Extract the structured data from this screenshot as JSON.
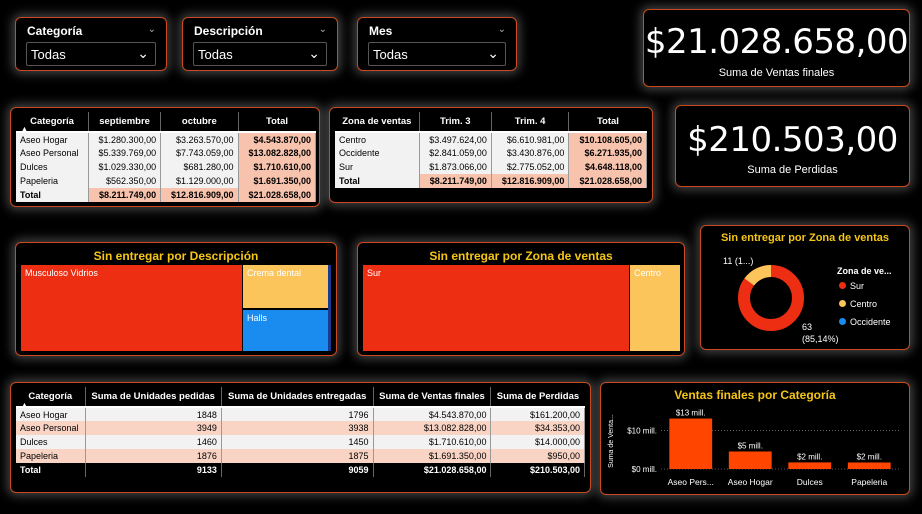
{
  "slicers": [
    {
      "title": "Categoría",
      "value": "Todas"
    },
    {
      "title": "Descripción",
      "value": "Todas"
    },
    {
      "title": "Mes",
      "value": "Todas"
    }
  ],
  "kpi_sales": {
    "value": "$21.028.658,00",
    "label": "Suma de Ventas finales"
  },
  "kpi_losses": {
    "value": "$210.503,00",
    "label": "Suma de Perdidas"
  },
  "table_month": {
    "headers": [
      "Categoría",
      "septiembre",
      "octubre",
      "Total"
    ],
    "rows": [
      [
        "Aseo Hogar",
        "$1.280.300,00",
        "$3.263.570,00",
        "$4.543.870,00"
      ],
      [
        "Aseo Personal",
        "$5.339.769,00",
        "$7.743.059,00",
        "$13.082.828,00"
      ],
      [
        "Dulces",
        "$1.029.330,00",
        "$681.280,00",
        "$1.710.610,00"
      ],
      [
        "Papeleria",
        "$562.350,00",
        "$1.129.000,00",
        "$1.691.350,00"
      ]
    ],
    "total": [
      "Total",
      "$8.211.749,00",
      "$12.816.909,00",
      "$21.028.658,00"
    ]
  },
  "table_zone": {
    "headers": [
      "Zona de ventas",
      "Trim. 3",
      "Trim. 4",
      "Total"
    ],
    "rows": [
      [
        "Centro",
        "$3.497.624,00",
        "$6.610.981,00",
        "$10.108.605,00"
      ],
      [
        "Occidente",
        "$2.841.059,00",
        "$3.430.876,00",
        "$6.271.935,00"
      ],
      [
        "Sur",
        "$1.873.066,00",
        "$2.775.052,00",
        "$4.648.118,00"
      ]
    ],
    "total": [
      "Total",
      "$8.211.749,00",
      "$12.816.909,00",
      "$21.028.658,00"
    ]
  },
  "treemap_desc": {
    "title": "Sin entregar por Descripción",
    "cells": [
      {
        "label": "Musculoso Vidrios",
        "color": "#ee2e13"
      },
      {
        "label": "Crema dental",
        "color": "#fbc55c"
      },
      {
        "label": "Halls",
        "color": "#1a8cf0"
      }
    ]
  },
  "treemap_zone": {
    "title": "Sin entregar por Zona de ventas",
    "cells": [
      {
        "label": "Sur",
        "color": "#ee2e13"
      },
      {
        "label": "Centro",
        "color": "#fbc55c"
      }
    ]
  },
  "donut": {
    "title": "Sin entregar por Zona de ventas",
    "legend_title": "Zona de ve...",
    "legend": [
      {
        "label": "Sur",
        "color": "#ee2e13"
      },
      {
        "label": "Centro",
        "color": "#fbc55c"
      },
      {
        "label": "Occidente",
        "color": "#1a8cf0"
      }
    ],
    "label_small": "11 (1...)",
    "label_big_1": "63",
    "label_big_2": "(85,14%)",
    "values": [
      63,
      11
    ]
  },
  "table_units": {
    "headers": [
      "Categoría",
      "Suma de Unidades pedidas",
      "Suma de Unidades entregadas",
      "Suma de Ventas finales",
      "Suma de Perdidas"
    ],
    "rows": [
      [
        "Aseo Hogar",
        "1848",
        "1796",
        "$4.543.870,00",
        "$161.200,00"
      ],
      [
        "Aseo Personal",
        "3949",
        "3938",
        "$13.082.828,00",
        "$34.353,00"
      ],
      [
        "Dulces",
        "1460",
        "1450",
        "$1.710.610,00",
        "$14.000,00"
      ],
      [
        "Papeleria",
        "1876",
        "1875",
        "$1.691.350,00",
        "$950,00"
      ]
    ],
    "total": [
      "Total",
      "9133",
      "9059",
      "$21.028.658,00",
      "$210.503,00"
    ]
  },
  "chart_data": {
    "type": "bar",
    "title": "Ventas finales por Categoría",
    "ylabel": "Suma de Venta...",
    "categories": [
      "Aseo Pers...",
      "Aseo Hogar",
      "Dulces",
      "Papeleria"
    ],
    "values": [
      13082828,
      4543870,
      1710610,
      1691350
    ],
    "data_labels": [
      "$13 mill.",
      "$5 mill.",
      "$2 mill.",
      "$2 mill."
    ],
    "y_ticks": [
      "$0 mill.",
      "$10 mill."
    ],
    "ylim": [
      0,
      14000000
    ],
    "color": "#ff4500"
  }
}
